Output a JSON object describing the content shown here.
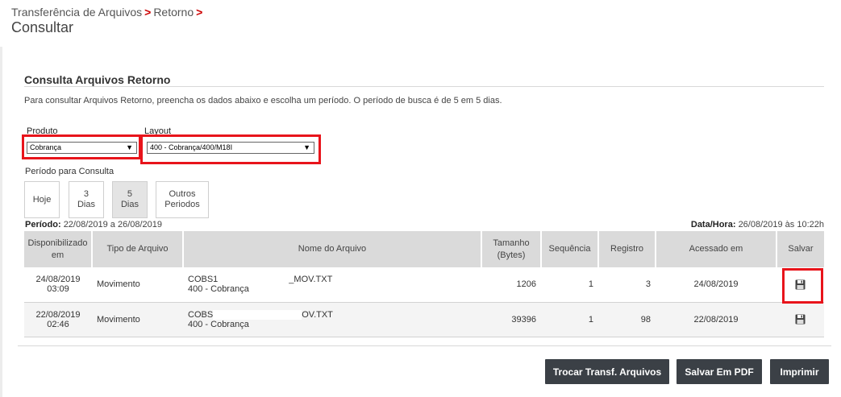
{
  "breadcrumb": {
    "item1": "Transferência de Arquivos",
    "item2": "Retorno",
    "separator": ">"
  },
  "page_title": "Consultar",
  "section": {
    "title": "Consulta Arquivos Retorno",
    "instructions": "Para consultar Arquivos Retorno, preencha os dados abaixo e escolha um período. O período de busca é de 5 em 5 dias."
  },
  "form": {
    "produto_label": "Produto",
    "produto_value": "Cobrança",
    "layout_label": "Layout",
    "layout_value": "400 - Cobrança/400/M18I",
    "periodo_label": "Período para Consulta",
    "buttons": {
      "hoje": "Hoje",
      "tres_dias_line1": "3",
      "tres_dias_line2": "Dias",
      "cinco_dias_line1": "5",
      "cinco_dias_line2": "Dias",
      "outros_line1": "Outros",
      "outros_line2": "Periodos"
    },
    "active_period": "5 Dias"
  },
  "period_info": {
    "periodo_label": "Período:",
    "periodo_value": "22/08/2019 a 26/08/2019",
    "datahora_label": "Data/Hora:",
    "datahora_value": "26/08/2019 às 10:22h"
  },
  "table": {
    "headers": {
      "disponibilizado_1": "Disponibilizado",
      "disponibilizado_2": "em",
      "tipo": "Tipo de Arquivo",
      "nome": "Nome do Arquivo",
      "tamanho_1": "Tamanho",
      "tamanho_2": "(Bytes)",
      "sequencia": "Sequência",
      "registro": "Registro",
      "acessado": "Acessado em",
      "salvar": "Salvar"
    },
    "rows": [
      {
        "date": "24/08/2019",
        "time": "03:09",
        "tipo": "Movimento",
        "nome_prefix": "COBS1",
        "nome_suffix": "_MOV.TXT",
        "nome_line2": "400 - Cobrança",
        "tamanho": "1206",
        "sequencia": "1",
        "registro": "3",
        "acessado": "24/08/2019"
      },
      {
        "date": "22/08/2019",
        "time": "02:46",
        "tipo": "Movimento",
        "nome_prefix": "COBS",
        "nome_suffix": "OV.TXT",
        "nome_line2": "400 - Cobrança",
        "tamanho": "39396",
        "sequencia": "1",
        "registro": "98",
        "acessado": "22/08/2019"
      }
    ]
  },
  "actions": {
    "trocar": "Trocar Transf. Arquivos",
    "pdf": "Salvar Em PDF",
    "imprimir": "Imprimir"
  },
  "icons": {
    "save": "floppy-disk-icon",
    "select_caret": "triangle-down"
  },
  "colors": {
    "highlight": "#e8141b",
    "separator": "#cc0000",
    "button_bg": "#3b4046",
    "header_bg": "#dadada"
  }
}
